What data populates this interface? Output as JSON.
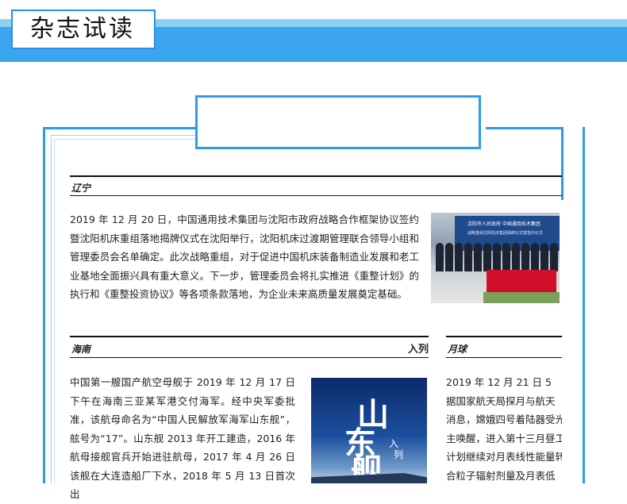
{
  "header": {
    "title": "杂志试读"
  },
  "sections": {
    "liaoning": {
      "tag": "辽宁",
      "paragraph": "2019 年 12 月 20 日，中国通用技术集团与沈阳市政府战略合作框架协议签约暨沈阳机床重组落地揭牌仪式在沈阳举行，沈阳机床过渡期管理联合领导小组和管理委员会名单确定。此次战略重组，对于促进中国机床装备制造业发展和老工业基地全面振兴具有重大意义。下一步，管理委员会将扎实推进《重整计划》的执行和《重整投资协议》等各项条款落地，为企业未来高质量发展奠定基础。",
      "photo_banner_line1": "沈阳市人民政府  中国通用技术集团",
      "photo_banner_line2": "战略重组沈阳机床集团揭牌仪式暨签约仪式"
    },
    "hainan": {
      "tag": "海南",
      "right_tag": "入列",
      "paragraph": "中国第一艘国产航空母舰于 2019 年 12 月 17 日下午在海南三亚某军港交付海军。经中央军委批准，该航母命名为“中国人民解放军海军山东舰”，舷号为“17”。山东舰 2013 年开工建造，2016 年航母接舰官兵开始进驻航母，2017 年 4 月 26 日该舰在大连造船厂下水，2018 年 5 月 13 日首次出",
      "cover_title_1": "山",
      "cover_title_2": "东",
      "cover_title_3": "舰",
      "cover_sub_1": "入",
      "cover_sub_2": "列"
    },
    "moon": {
      "tag": "月球",
      "lines": [
        "2019 年 12 月 21 日 5",
        "据国家航天局探月与航天",
        "消息，嫦娥四号着陆器受光",
        "主唤醒，进入第十三月昼工",
        "计划继续对月表线性能量转",
        "合粒子辐射剂量及月表低"
      ]
    }
  },
  "colors": {
    "accent": "#2c9be8",
    "band": "#3ba6ee",
    "band_light": "#8fd0f7"
  }
}
